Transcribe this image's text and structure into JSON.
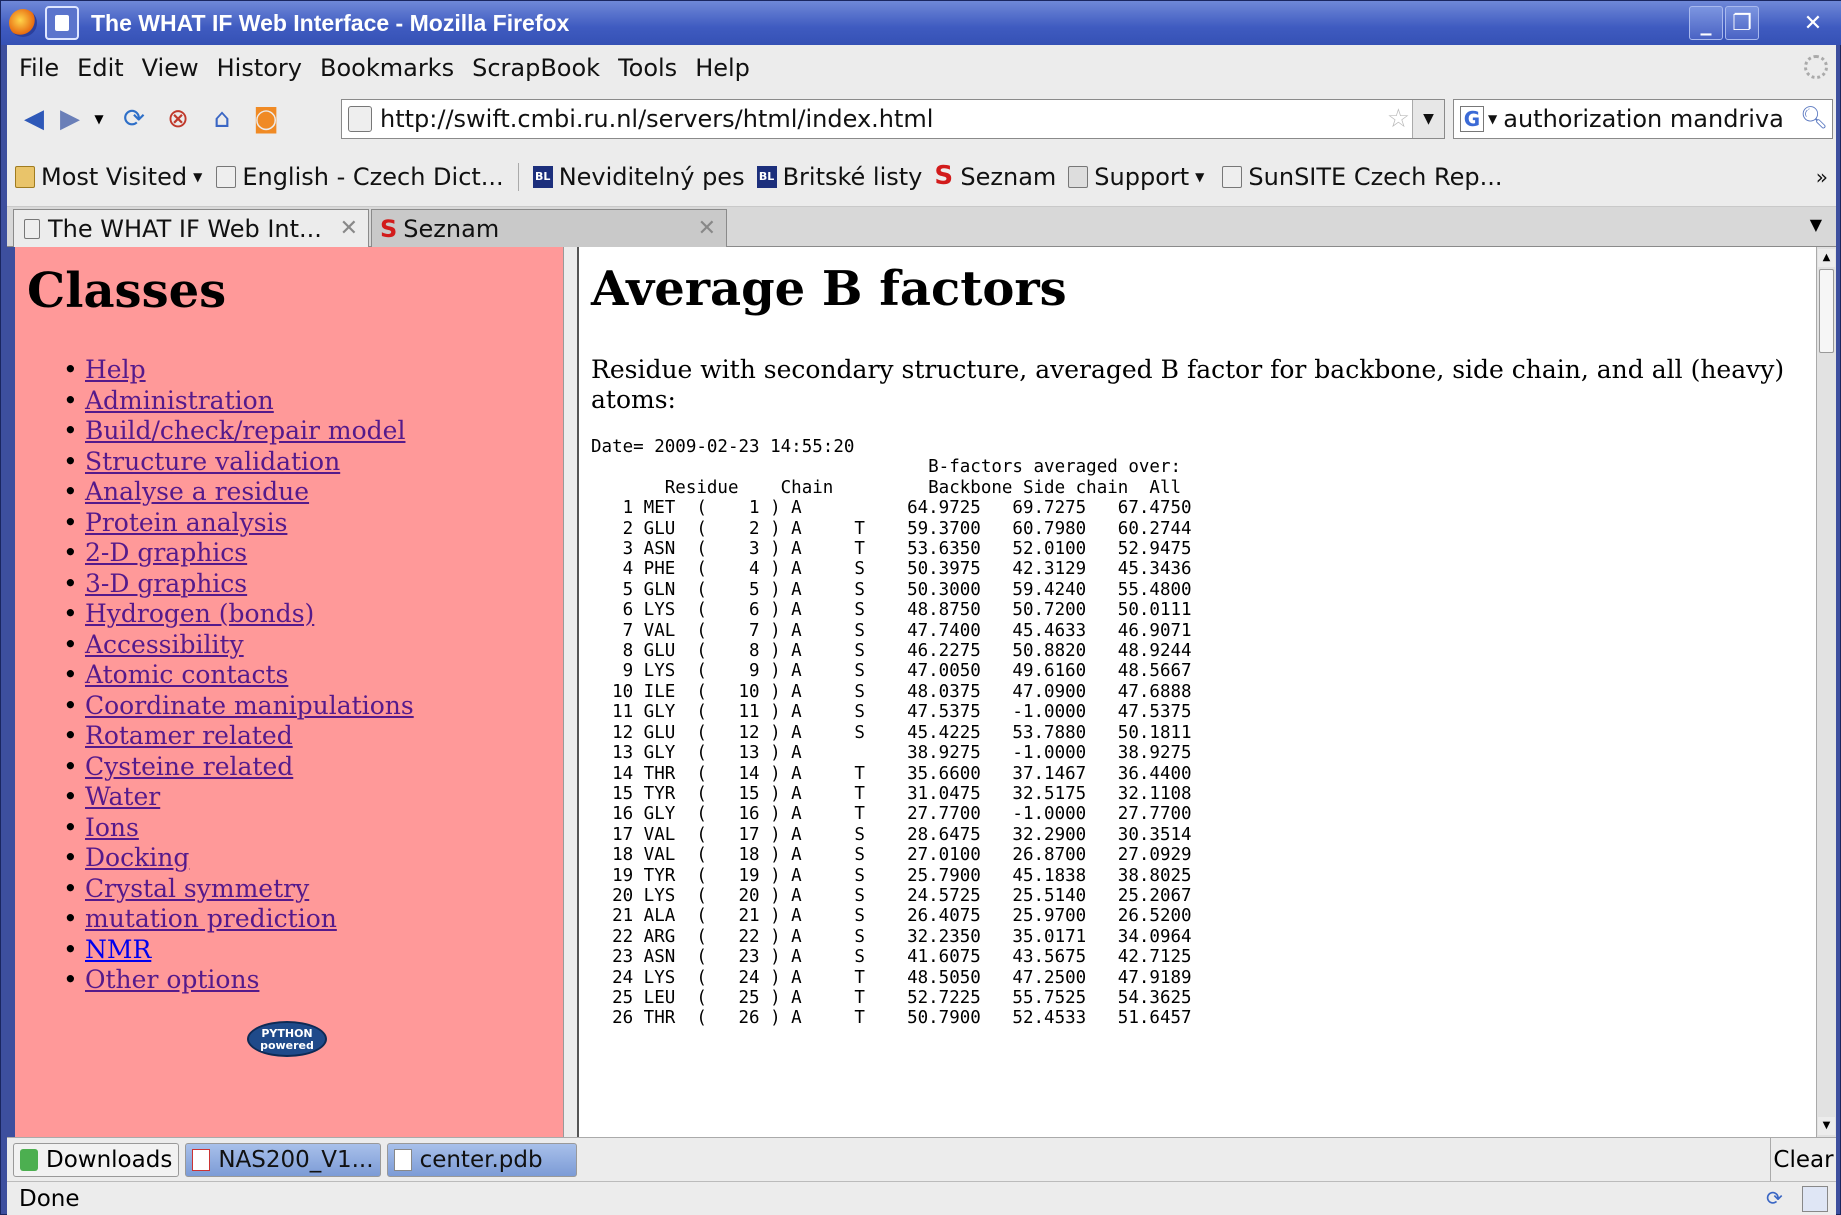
{
  "window": {
    "title": "The WHAT IF Web Interface - Mozilla Firefox"
  },
  "menu": [
    "File",
    "Edit",
    "View",
    "History",
    "Bookmarks",
    "ScrapBook",
    "Tools",
    "Help"
  ],
  "nav": {
    "url": "http://swift.cmbi.ru.nl/servers/html/index.html",
    "search_value": "authorization mandriva"
  },
  "bookmarks": [
    {
      "label": "Most Visited",
      "icon": "folder",
      "dropdown": true
    },
    {
      "label": "English - Czech Dict...",
      "icon": "page",
      "dropdown": false
    },
    {
      "label": "Neviditelný pes",
      "icon": "bl",
      "dropdown": false
    },
    {
      "label": "Britské listy",
      "icon": "bl",
      "dropdown": false
    },
    {
      "label": "Seznam",
      "icon": "s",
      "dropdown": false
    },
    {
      "label": "Support",
      "icon": "folder",
      "dropdown": true
    },
    {
      "label": "SunSITE Czech Rep...",
      "icon": "page",
      "dropdown": false
    }
  ],
  "tabs": [
    {
      "label": "The WHAT IF Web Int...",
      "active": true
    },
    {
      "label": "Seznam",
      "active": false
    }
  ],
  "left": {
    "heading": "Classes",
    "links": [
      "Help",
      "Administration",
      "Build/check/repair model",
      "Structure validation",
      "Analyse a residue",
      "Protein analysis",
      "2-D graphics",
      "3-D graphics",
      "Hydrogen (bonds)",
      "Accessibility",
      "Atomic contacts",
      "Coordinate manipulations",
      "Rotamer related",
      "Cysteine related",
      "Water",
      "Ions",
      "Docking",
      "Crystal symmetry",
      "mutation prediction",
      "NMR",
      "Other options"
    ],
    "unvisited_link": "NMR",
    "python_badge": "PYTHON\npowered"
  },
  "right": {
    "heading": "Average B factors",
    "intro": "Residue with secondary structure, averaged B factor for backbone, side chain, and all (heavy) atoms:",
    "date_line": "Date= 2009-02-23 14:55:20",
    "header_line1": "B-factors averaged over:",
    "col_residue": "Residue",
    "col_chain": "Chain",
    "col_backbone": "Backbone",
    "col_side": "Side chain",
    "col_all": "All",
    "rows": [
      [
        "1",
        "MET",
        "1",
        "A",
        "",
        "64.9725",
        "69.7275",
        "67.4750"
      ],
      [
        "2",
        "GLU",
        "2",
        "A",
        "T",
        "59.3700",
        "60.7980",
        "60.2744"
      ],
      [
        "3",
        "ASN",
        "3",
        "A",
        "T",
        "53.6350",
        "52.0100",
        "52.9475"
      ],
      [
        "4",
        "PHE",
        "4",
        "A",
        "S",
        "50.3975",
        "42.3129",
        "45.3436"
      ],
      [
        "5",
        "GLN",
        "5",
        "A",
        "S",
        "50.3000",
        "59.4240",
        "55.4800"
      ],
      [
        "6",
        "LYS",
        "6",
        "A",
        "S",
        "48.8750",
        "50.7200",
        "50.0111"
      ],
      [
        "7",
        "VAL",
        "7",
        "A",
        "S",
        "47.7400",
        "45.4633",
        "46.9071"
      ],
      [
        "8",
        "GLU",
        "8",
        "A",
        "S",
        "46.2275",
        "50.8820",
        "48.9244"
      ],
      [
        "9",
        "LYS",
        "9",
        "A",
        "S",
        "47.0050",
        "49.6160",
        "48.5667"
      ],
      [
        "10",
        "ILE",
        "10",
        "A",
        "S",
        "48.0375",
        "47.0900",
        "47.6888"
      ],
      [
        "11",
        "GLY",
        "11",
        "A",
        "S",
        "47.5375",
        "-1.0000",
        "47.5375"
      ],
      [
        "12",
        "GLU",
        "12",
        "A",
        "S",
        "45.4225",
        "53.7880",
        "50.1811"
      ],
      [
        "13",
        "GLY",
        "13",
        "A",
        "",
        "38.9275",
        "-1.0000",
        "38.9275"
      ],
      [
        "14",
        "THR",
        "14",
        "A",
        "T",
        "35.6600",
        "37.1467",
        "36.4400"
      ],
      [
        "15",
        "TYR",
        "15",
        "A",
        "T",
        "31.0475",
        "32.5175",
        "32.1108"
      ],
      [
        "16",
        "GLY",
        "16",
        "A",
        "T",
        "27.7700",
        "-1.0000",
        "27.7700"
      ],
      [
        "17",
        "VAL",
        "17",
        "A",
        "S",
        "28.6475",
        "32.2900",
        "30.3514"
      ],
      [
        "18",
        "VAL",
        "18",
        "A",
        "S",
        "27.0100",
        "26.8700",
        "27.0929"
      ],
      [
        "19",
        "TYR",
        "19",
        "A",
        "S",
        "25.7900",
        "45.1838",
        "38.8025"
      ],
      [
        "20",
        "LYS",
        "20",
        "A",
        "S",
        "24.5725",
        "25.5140",
        "25.2067"
      ],
      [
        "21",
        "ALA",
        "21",
        "A",
        "S",
        "26.4075",
        "25.9700",
        "26.5200"
      ],
      [
        "22",
        "ARG",
        "22",
        "A",
        "S",
        "32.2350",
        "35.0171",
        "34.0964"
      ],
      [
        "23",
        "ASN",
        "23",
        "A",
        "S",
        "41.6075",
        "43.5675",
        "42.7125"
      ],
      [
        "24",
        "LYS",
        "24",
        "A",
        "T",
        "48.5050",
        "47.2500",
        "47.9189"
      ],
      [
        "25",
        "LEU",
        "25",
        "A",
        "T",
        "52.7225",
        "55.7525",
        "54.3625"
      ],
      [
        "26",
        "THR",
        "26",
        "A",
        "T",
        "50.7900",
        "52.4533",
        "51.6457"
      ]
    ]
  },
  "downloads": {
    "label": "Downloads",
    "files": [
      "NAS200_V1...",
      "center.pdb"
    ],
    "clear_label": "Clear"
  },
  "status": {
    "text": "Done"
  }
}
